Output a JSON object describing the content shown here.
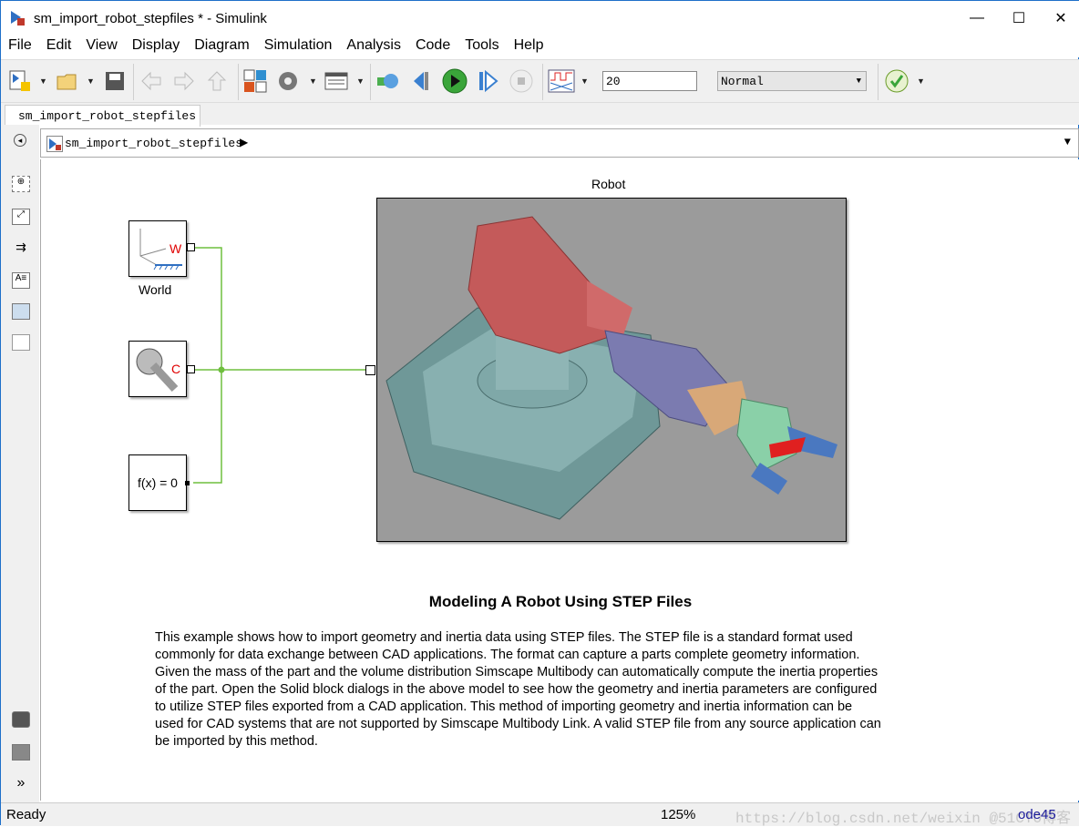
{
  "window": {
    "title": "sm_import_robot_stepfiles * - Simulink",
    "minimize": "—",
    "maximize": "☐",
    "close": "✕"
  },
  "menu": [
    "File",
    "Edit",
    "View",
    "Display",
    "Diagram",
    "Simulation",
    "Analysis",
    "Code",
    "Tools",
    "Help"
  ],
  "toolbar": {
    "stop_time": "20",
    "sim_mode": "Normal"
  },
  "tab": {
    "label": "sm_import_robot_stepfiles"
  },
  "breadcrumb": {
    "model": "sm_import_robot_stepfiles"
  },
  "blocks": {
    "world": {
      "label": "World",
      "port_letter": "W"
    },
    "config": {
      "port_letter": "C"
    },
    "solver": {
      "text": "f(x) = 0"
    },
    "robot": {
      "label": "Robot"
    }
  },
  "annotation": {
    "title": "Modeling A Robot Using STEP Files",
    "lines": [
      "This example shows how to import geometry and inertia data using STEP files. The STEP file is a standard format used",
      "commonly for data exchange between CAD applications. The format can capture a parts complete geometry information.",
      "Given the mass of the part and the volume distribution Simscape Multibody can automatically compute the inertia properties",
      "of the part. Open the Solid block dialogs in the above model to see how the geometry and inertia parameters are configured",
      "to utilize STEP files exported from a CAD  application. This method of importing geometry and inertia information can be",
      "used for CAD systems that are not supported by Simscape Multibody Link. A valid STEP file from any source application can",
      "be imported by this method."
    ]
  },
  "status": {
    "state": "Ready",
    "zoom": "125%",
    "solver": "ode45",
    "watermark": "https://blog.csdn.net/weixin @51CTO博客"
  },
  "colors": {
    "signal_line": "#6fbf3f",
    "port_red": "#e00000",
    "run_green": "#3aa53a"
  }
}
